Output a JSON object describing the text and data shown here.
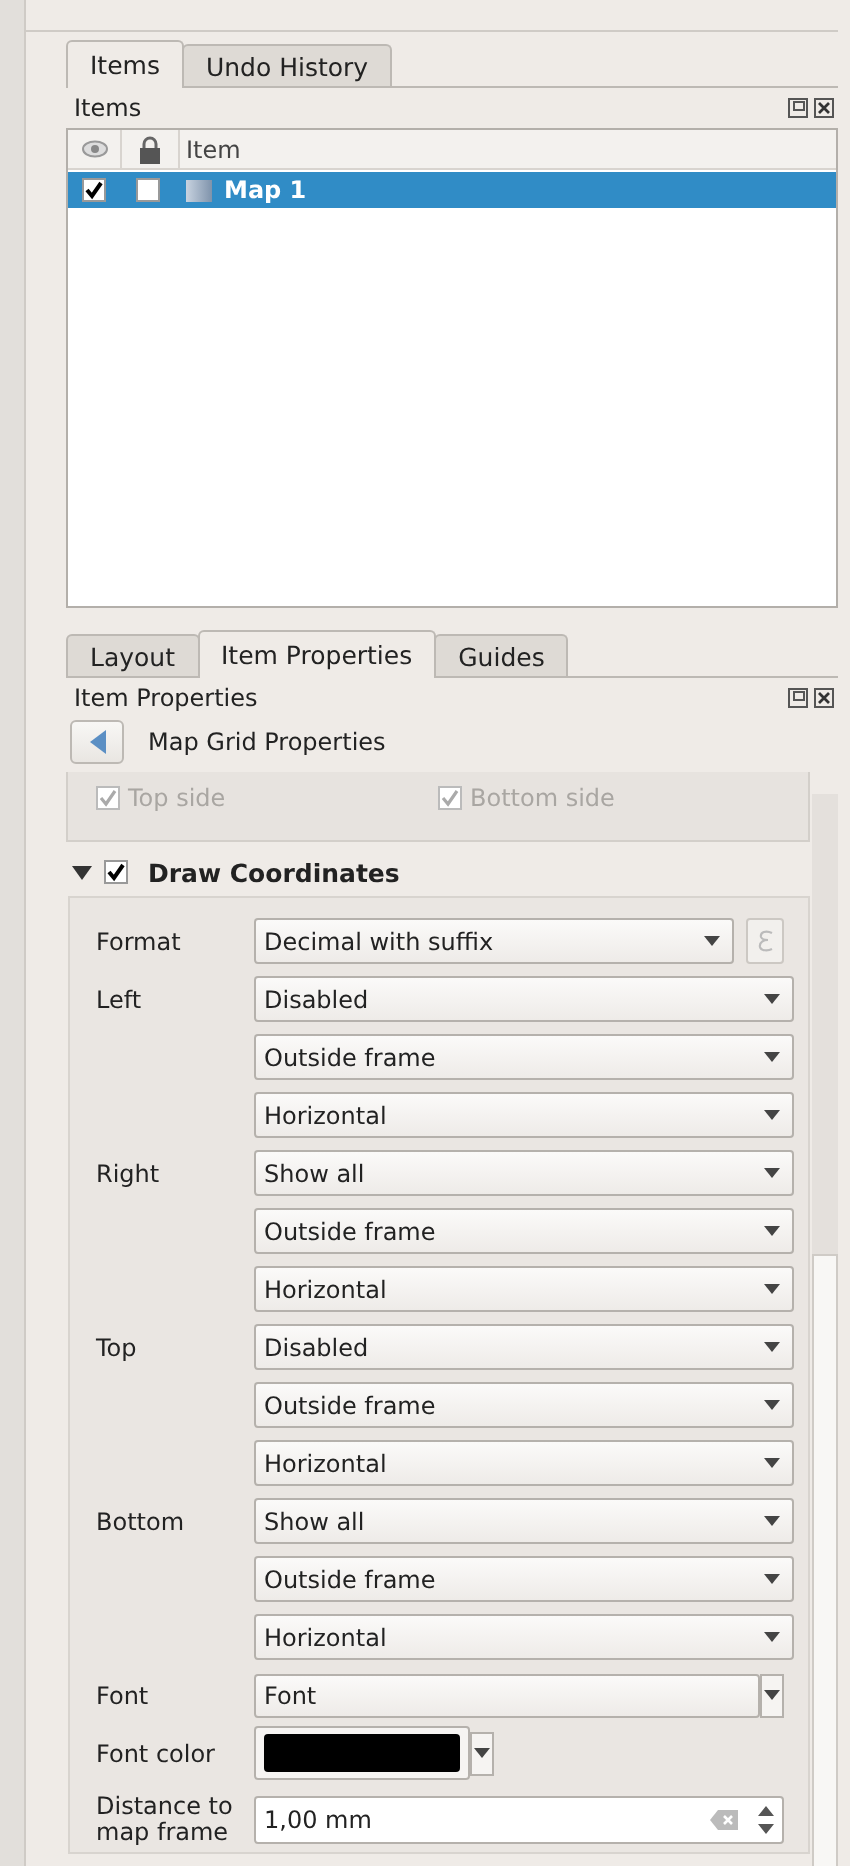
{
  "top_tabs": [
    {
      "label": "Items",
      "selected": true
    },
    {
      "label": "Undo History",
      "selected": false
    }
  ],
  "items_panel": {
    "title": "Items",
    "column_label": "Item",
    "rows": [
      {
        "name": "Map 1",
        "visible": true,
        "locked": false,
        "selected": true
      }
    ]
  },
  "bottom_tabs": [
    {
      "label": "Layout",
      "selected": false
    },
    {
      "label": "Item Properties",
      "selected": true
    },
    {
      "label": "Guides",
      "selected": false
    }
  ],
  "properties_panel": {
    "title": "Item Properties",
    "subtitle": "Map Grid Properties",
    "sides": [
      {
        "label": "Top side",
        "checked": true,
        "disabled": true
      },
      {
        "label": "Bottom side",
        "checked": true,
        "disabled": true
      }
    ],
    "section": {
      "title": "Draw Coordinates",
      "expanded": true,
      "checked": true
    },
    "format": {
      "label": "Format",
      "value": "Decimal with suffix"
    },
    "positions": [
      {
        "label": "Left",
        "values": [
          "Disabled",
          "Outside frame",
          "Horizontal"
        ]
      },
      {
        "label": "Right",
        "values": [
          "Show all",
          "Outside frame",
          "Horizontal"
        ]
      },
      {
        "label": "Top",
        "values": [
          "Disabled",
          "Outside frame",
          "Horizontal"
        ]
      },
      {
        "label": "Bottom",
        "values": [
          "Show all",
          "Outside frame",
          "Horizontal"
        ]
      }
    ],
    "font": {
      "label": "Font",
      "value": "Font"
    },
    "font_color": {
      "label": "Font color",
      "color": "#000000"
    },
    "distance": {
      "label": "Distance to map frame",
      "value": "1,00 mm"
    }
  }
}
